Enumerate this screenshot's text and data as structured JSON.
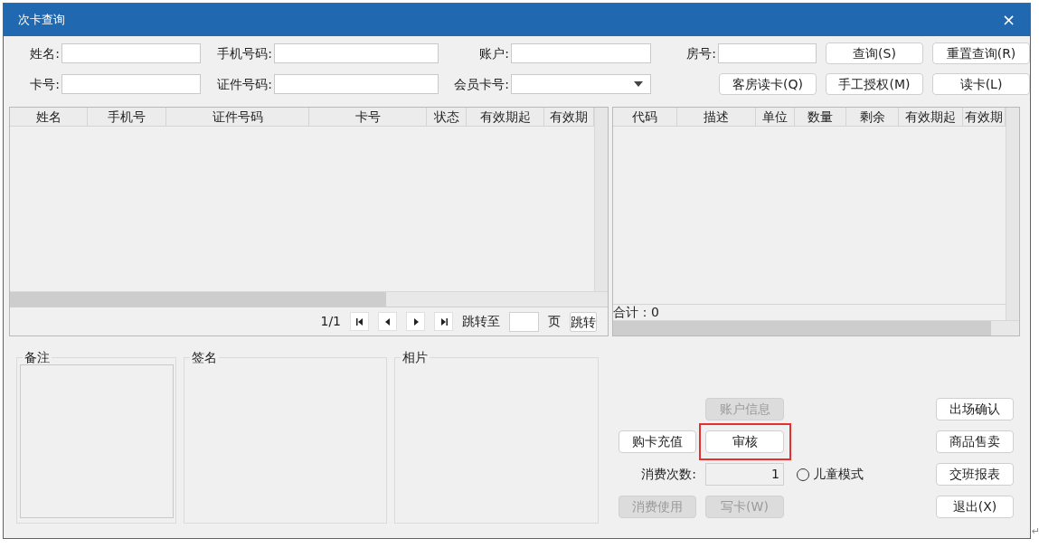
{
  "window": {
    "title": "次卡查询",
    "close": "×"
  },
  "search_rows": [
    [
      {
        "kind": "field",
        "label": "姓名:"
      },
      {
        "kind": "field",
        "label": "手机号码:"
      },
      {
        "kind": "field",
        "label": "账户:"
      },
      {
        "kind": "field",
        "label": "房号:"
      },
      {
        "kind": "button",
        "label": "查询(S)"
      },
      {
        "kind": "button",
        "label": "重置查询(R)"
      }
    ],
    [
      {
        "kind": "field",
        "label": "卡号:"
      },
      {
        "kind": "field",
        "label": "证件号码:"
      },
      {
        "kind": "dropdown",
        "label": "会员卡号:"
      },
      {
        "kind": "button",
        "label": "客房读卡(Q)"
      },
      {
        "kind": "button",
        "label": "手工授权(M)"
      },
      {
        "kind": "button",
        "label": "读卡(L)"
      }
    ]
  ],
  "member_table": {
    "columns": [
      "姓名",
      "手机号",
      "证件号码",
      "卡号",
      "状态",
      "有效期起",
      "有效期"
    ],
    "pager": {
      "page": "1/1",
      "jump_label": "跳转至",
      "page_unit": "页",
      "jump_button": "跳转"
    }
  },
  "items_table": {
    "columns": [
      "代码",
      "描述",
      "单位",
      "数量",
      "剩余",
      "有效期起",
      "有效期"
    ],
    "total": "合计：0"
  },
  "panels": [
    {
      "title": "备注",
      "kind": "memo"
    },
    {
      "title": "签名",
      "kind": "blank"
    },
    {
      "title": "相片",
      "kind": "blank"
    }
  ],
  "actions": {
    "account_info": {
      "label": "账户信息",
      "disabled": true,
      "highlighted": false
    },
    "purchase": {
      "label": "购卡充值",
      "disabled": false,
      "highlighted": false
    },
    "review": {
      "label": "审核",
      "disabled": false,
      "highlighted": true
    },
    "count": {
      "label": "消费次数:",
      "value": "1"
    },
    "child_mode": {
      "label": "儿童模式",
      "checked": false
    },
    "consume": {
      "label": "消费使用",
      "disabled": true,
      "highlighted": false
    },
    "write_card": {
      "label": "写卡(W)",
      "disabled": true,
      "highlighted": false
    }
  },
  "side_buttons": [
    {
      "label": "出场确认"
    },
    {
      "label": "商品售卖"
    },
    {
      "label": "交班报表"
    },
    {
      "label": "退出(X)"
    }
  ],
  "page_mark": "↵"
}
